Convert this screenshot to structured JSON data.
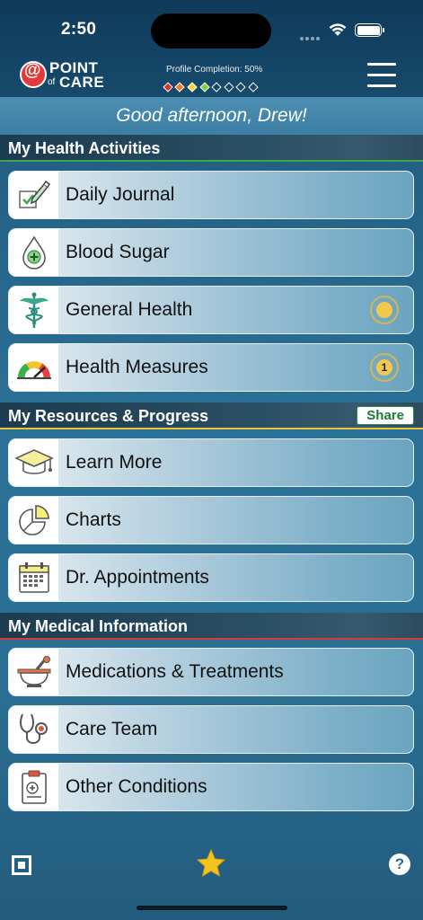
{
  "status": {
    "time": "2:50"
  },
  "header": {
    "logo": {
      "point": "POINT",
      "of": "of",
      "care": "CARE"
    },
    "profile_completion_label": "Profile Completion: 50%",
    "profile_completion": 0.5,
    "diamond_colors": [
      "#e03030",
      "#f07a2a",
      "#f4d534",
      "#7ad23a",
      "#ffffff00",
      "#ffffff00",
      "#ffffff00",
      "#ffffff00"
    ]
  },
  "greeting": "Good afternoon, Drew!",
  "sections": {
    "health": {
      "title": "My Health Activities",
      "accent": "#3aa84a",
      "items": [
        {
          "label": "Daily Journal",
          "icon": "journal-icon"
        },
        {
          "label": "Blood Sugar",
          "icon": "blood-drop-icon"
        },
        {
          "label": "General Health",
          "icon": "caduceus-icon",
          "badge": ""
        },
        {
          "label": "Health Measures",
          "icon": "gauge-icon",
          "badge": "1"
        }
      ]
    },
    "resources": {
      "title": "My Resources & Progress",
      "share_label": "Share",
      "accent": "#e8c53a",
      "items": [
        {
          "label": "Learn More",
          "icon": "graduation-cap-icon"
        },
        {
          "label": "Charts",
          "icon": "pie-chart-icon"
        },
        {
          "label": "Dr. Appointments",
          "icon": "calendar-icon"
        }
      ]
    },
    "medical": {
      "title": "My Medical Information",
      "accent": "#d43a3a",
      "items": [
        {
          "label": "Medications & Treatments",
          "icon": "mortar-pestle-icon"
        },
        {
          "label": "Care Team",
          "icon": "stethoscope-icon"
        },
        {
          "label": "Other Conditions",
          "icon": "clipboard-icon"
        }
      ]
    }
  },
  "bottom": {
    "left_icon": "scan-icon",
    "center_icon": "star-icon",
    "right_icon": "help-icon",
    "help_text": "?"
  }
}
